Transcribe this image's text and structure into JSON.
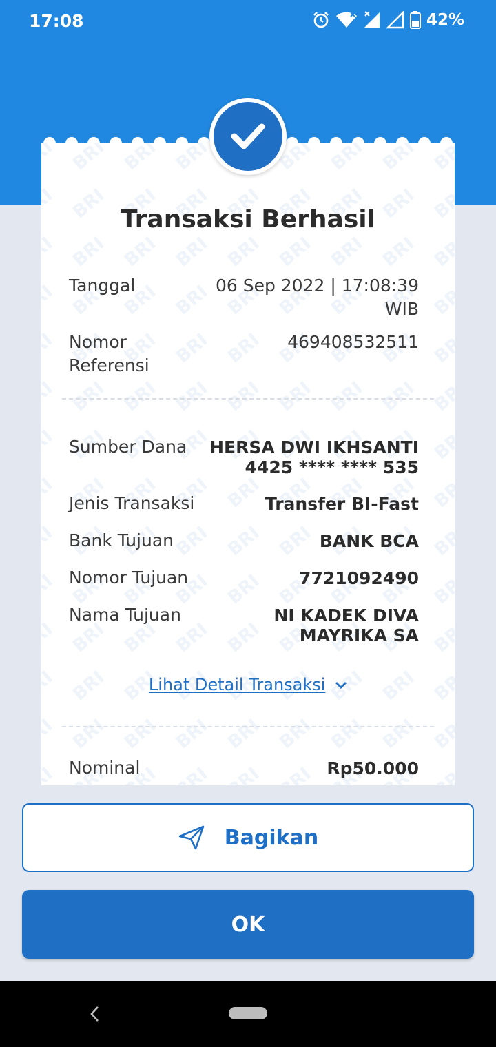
{
  "status_bar": {
    "time": "17:08",
    "battery": "42%"
  },
  "receipt": {
    "title": "Transaksi Berhasil",
    "watermark": "BRI",
    "header_rows": [
      {
        "label": "Tanggal",
        "value_line1": "06 Sep 2022 | 17:08:39",
        "value_line2": "WIB"
      },
      {
        "label_line1": "Nomor",
        "label_line2": "Referensi",
        "value": "469408532511"
      }
    ],
    "rows": [
      {
        "label": "Sumber Dana",
        "value_line1": "HERSA DWI IKHSANTI",
        "value_line2": "4425 **** **** 535"
      },
      {
        "label": "Jenis Transaksi",
        "value": "Transfer BI-Fast"
      },
      {
        "label": "Bank Tujuan",
        "value": "BANK BCA"
      },
      {
        "label": "Nomor Tujuan",
        "value": "7721092490"
      },
      {
        "label": "Nama Tujuan",
        "value_line1": "NI KADEK DIVA",
        "value_line2": "MAYRIKA SA"
      }
    ],
    "detail_link": "Lihat Detail Transaksi",
    "nominal": {
      "label": "Nominal",
      "value": "Rp50.000"
    }
  },
  "actions": {
    "share_label": "Bagikan",
    "ok_label": "OK"
  },
  "colors": {
    "header_blue": "#2088e0",
    "primary": "#1f6fc4",
    "background": "#e3e8f0"
  }
}
